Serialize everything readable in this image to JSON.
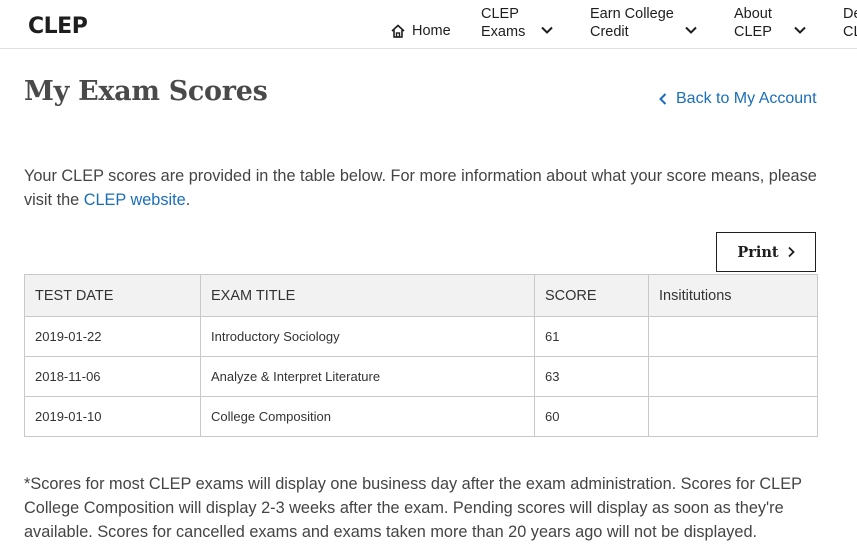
{
  "header": {
    "logo": "CLEP",
    "nav": {
      "home": "Home",
      "exams": "CLEP\nExams",
      "credit": "Earn College\nCredit",
      "about": "About\nCLEP",
      "more": "De\nCL"
    }
  },
  "page": {
    "title": "My Exam Scores",
    "back_link": "Back to My Account",
    "intro_text": "Your CLEP scores are provided in the table below. For more information about what your score means, please visit the ",
    "intro_link": "CLEP website",
    "intro_end": ".",
    "print_label": "Print"
  },
  "table": {
    "headers": [
      "TEST DATE",
      "EXAM TITLE",
      "SCORE",
      "Insititutions"
    ],
    "rows": [
      {
        "date": "2019-01-22",
        "title": "Introductory Sociology",
        "score": "61",
        "institutions": ""
      },
      {
        "date": "2018-11-06",
        "title": "Analyze & Interpret Literature",
        "score": "63",
        "institutions": ""
      },
      {
        "date": "2019-01-10",
        "title": "College Composition",
        "score": "60",
        "institutions": ""
      }
    ]
  },
  "footnote": "*Scores for most CLEP exams will display one business day after the exam administration. Scores for CLEP College Composition will display 2-3 weeks after the exam. Pending scores will display as soon as they're available. Scores for cancelled exams and exams taken more than 20 years ago will not be displayed.",
  "colors": {
    "link": "#1a6fb7",
    "text": "#333333",
    "table_header_bg": "#f2f2f2"
  },
  "icons": [
    "home-icon",
    "chevron-down-icon",
    "chevron-left-icon",
    "chevron-right-icon"
  ]
}
